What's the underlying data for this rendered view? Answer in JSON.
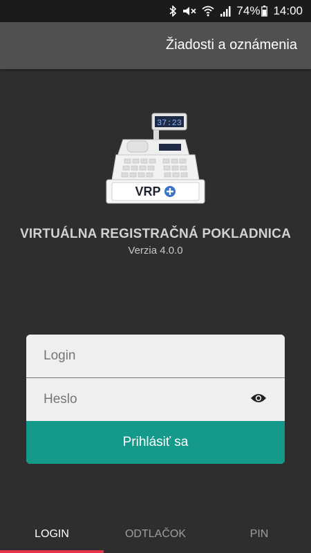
{
  "status_bar": {
    "battery_percent": "74%",
    "time": "14:00",
    "icons": [
      "bluetooth-icon",
      "mute-icon",
      "wifi-icon",
      "signal-icon",
      "battery-icon"
    ]
  },
  "header": {
    "link_label": "Žiadosti a oznámenia"
  },
  "logo": {
    "display_text": "37:23",
    "brand": "VRP",
    "icon": "cash-register-icon"
  },
  "app": {
    "title": "VIRTUÁLNA REGISTRAČNÁ POKLADNICA",
    "version": "Verzia 4.0.0"
  },
  "form": {
    "login_placeholder": "Login",
    "password_placeholder": "Heslo",
    "submit_label": "Prihlásiť sa",
    "accent_color": "#15998a"
  },
  "tabs": [
    {
      "label": "LOGIN",
      "active": true
    },
    {
      "label": "ODTLAČOK",
      "active": false
    },
    {
      "label": "PIN",
      "active": false
    }
  ],
  "colors": {
    "active_tab_indicator": "#e8344b"
  }
}
